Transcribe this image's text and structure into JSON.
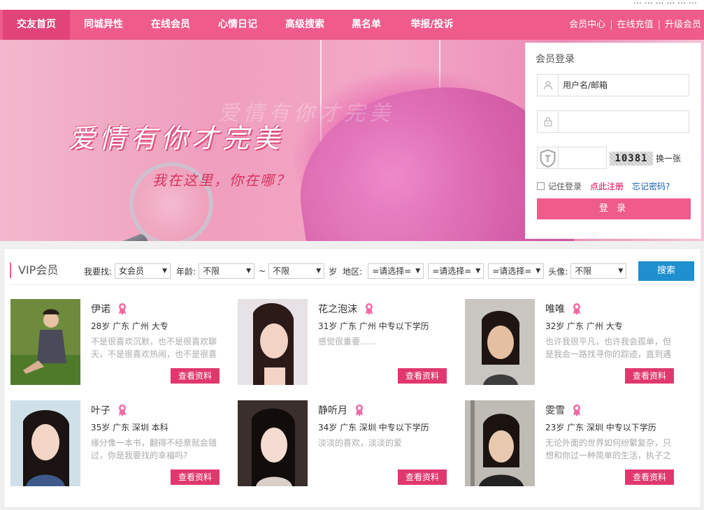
{
  "topbar": {
    "fragment": "… … …  …  … …"
  },
  "nav": {
    "items": [
      "交友首页",
      "同城异性",
      "在线会员",
      "心情日记",
      "高级搜索",
      "黑名单",
      "举报/投诉"
    ],
    "right_links": [
      "会员中心",
      "在线充值",
      "升级会员"
    ]
  },
  "banner": {
    "slogan_main": "爱情有你才完美",
    "slogan_ghost": "爱情有你才完美",
    "slogan_sub": "我在这里，你在哪？"
  },
  "login": {
    "title": "会员登录",
    "username_placeholder": "用户名/邮箱",
    "captcha_code": "10381",
    "refresh_label": "换一张",
    "remember_label": "记住登录",
    "register_label": "点此注册",
    "forgot_label": "忘记密码?",
    "submit_label": "登 录"
  },
  "vip": {
    "title": "VIP会员",
    "filter": {
      "looking_label": "我要找:",
      "looking_value": "女会员",
      "age_label": "年龄:",
      "age_from": "不限",
      "tilde": "~",
      "age_to": "不限",
      "age_unit": "岁",
      "region_label": "地区:",
      "region1": "=请选择=",
      "region2": "=请选择=",
      "region3": "=请选择=",
      "avatar_label": "头像:",
      "avatar_value": "不限",
      "search_label": "搜索"
    },
    "members": [
      {
        "name": "伊诺",
        "info": "28岁 广东 广州 大专",
        "desc": "不是很喜欢沉默，也不是很喜欢聊天，不是很喜欢热闹，也不是很喜",
        "button": "查看资料"
      },
      {
        "name": "花之泡沫",
        "info": "31岁 广东 广州 中专以下学历",
        "desc": "感觉很重要……",
        "button": "查看资料"
      },
      {
        "name": "唯唯",
        "info": "32岁 广东 广州 大专",
        "desc": "也许我很平凡，也许我会孤单，但是我会一路找寻你的踪迹，直到遇",
        "button": "查看资料"
      },
      {
        "name": "叶子",
        "info": "35岁 广东 深圳 本科",
        "desc": "缘分像一本书，翻得不经意就会错过，你是我要找的幸福吗?",
        "button": "查看资料"
      },
      {
        "name": "静听月",
        "info": "34岁 广东 深圳 中专以下学历",
        "desc": "淡淡的喜欢，淡淡的爱",
        "button": "查看资料"
      },
      {
        "name": "雯雪",
        "info": "23岁 广东 深圳 中专以下学历",
        "desc": "无论外面的世界如何纷繁复杂，只想和你过一种简单的生活，执子之",
        "button": "查看资料"
      }
    ]
  },
  "colors": {
    "primary_pink": "#ef5b8b",
    "button_pink": "#e0386d",
    "search_blue": "#1f8fd0",
    "link_red": "#e0004a",
    "link_blue": "#1560b5"
  }
}
